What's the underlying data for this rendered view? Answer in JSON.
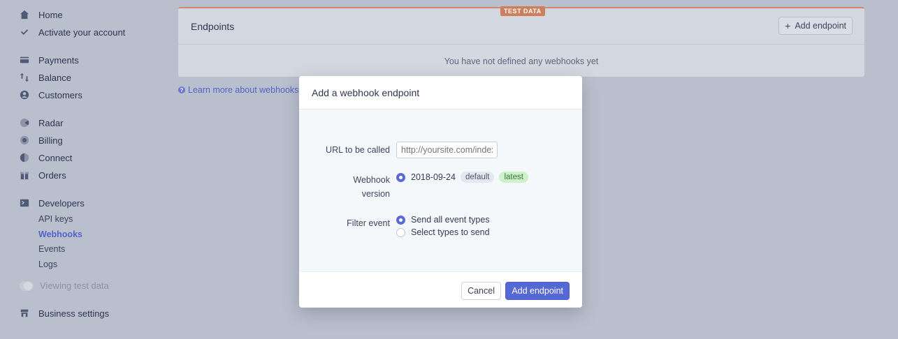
{
  "sidebar": {
    "items": [
      {
        "label": "Home",
        "icon": "home-icon"
      },
      {
        "label": "Activate your account",
        "icon": "check-icon"
      },
      {
        "label": "Payments",
        "icon": "payments-icon"
      },
      {
        "label": "Balance",
        "icon": "balance-icon"
      },
      {
        "label": "Customers",
        "icon": "customers-icon"
      },
      {
        "label": "Radar",
        "icon": "radar-icon"
      },
      {
        "label": "Billing",
        "icon": "billing-icon"
      },
      {
        "label": "Connect",
        "icon": "connect-icon"
      },
      {
        "label": "Orders",
        "icon": "orders-icon"
      },
      {
        "label": "Developers",
        "icon": "developers-icon"
      }
    ],
    "developer_subitems": [
      "API keys",
      "Webhooks",
      "Events",
      "Logs"
    ],
    "active_subitem": "Webhooks",
    "test_toggle_label": "Viewing test data",
    "business_settings": {
      "label": "Business settings",
      "icon": "business-icon"
    }
  },
  "card": {
    "badge": "TEST DATA",
    "title": "Endpoints",
    "add_button": "Add endpoint",
    "empty_message": "You have not defined any webhooks yet"
  },
  "learn_more": "Learn more about webhooks",
  "modal": {
    "title": "Add a webhook endpoint",
    "url_label": "URL to be called",
    "url_placeholder": "http://yoursite.com/index.php",
    "version_label_line1": "Webhook",
    "version_label_line2": "version",
    "version_value": "2018-09-24",
    "version_tag_default": "default",
    "version_tag_latest": "latest",
    "filter_label": "Filter event",
    "filter_options": [
      "Send all event types",
      "Select types to send"
    ],
    "filter_selected": "Send all event types",
    "cancel": "Cancel",
    "submit": "Add endpoint"
  },
  "colors": {
    "accent": "#5469d4",
    "background_overlay": "#b9bfcc",
    "test_badge": "#cf7e5c",
    "latest_tag": "#cdf1c9"
  }
}
